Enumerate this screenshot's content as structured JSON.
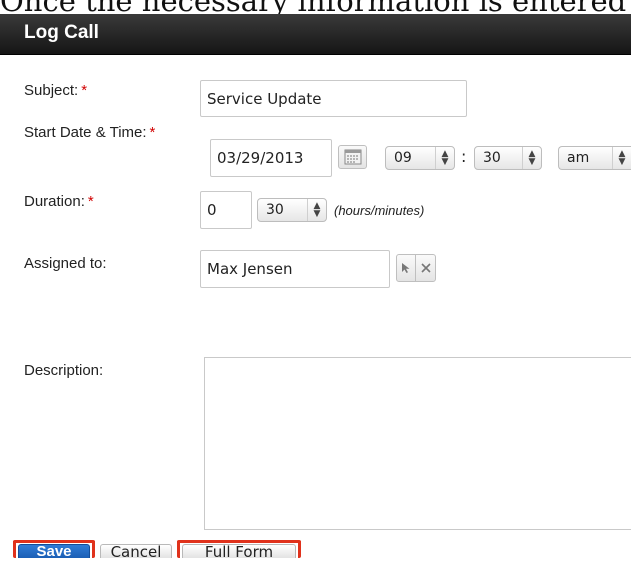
{
  "caption": "Once the necessary information is entered",
  "dialog": {
    "title": "Log Call"
  },
  "form": {
    "subject": {
      "label": "Subject:",
      "value": "Service Update"
    },
    "start": {
      "label": "Start Date & Time:",
      "date": "03/29/2013",
      "hour": "09",
      "minute": "30",
      "meridiem": "am",
      "separator": ":"
    },
    "duration": {
      "label": "Duration:",
      "hours": "0",
      "minutes": "30",
      "hint": "(hours/minutes)"
    },
    "assigned": {
      "label": "Assigned to:",
      "value": "Max Jensen"
    },
    "description": {
      "label": "Description:",
      "value": ""
    },
    "required_mark": "*"
  },
  "actions": {
    "save": "Save",
    "cancel": "Cancel",
    "full_form": "Full Form"
  },
  "colors": {
    "primary": "#1b5fb5",
    "highlight": "#e0321c",
    "required": "#d10000",
    "titlebar": "#151515"
  }
}
